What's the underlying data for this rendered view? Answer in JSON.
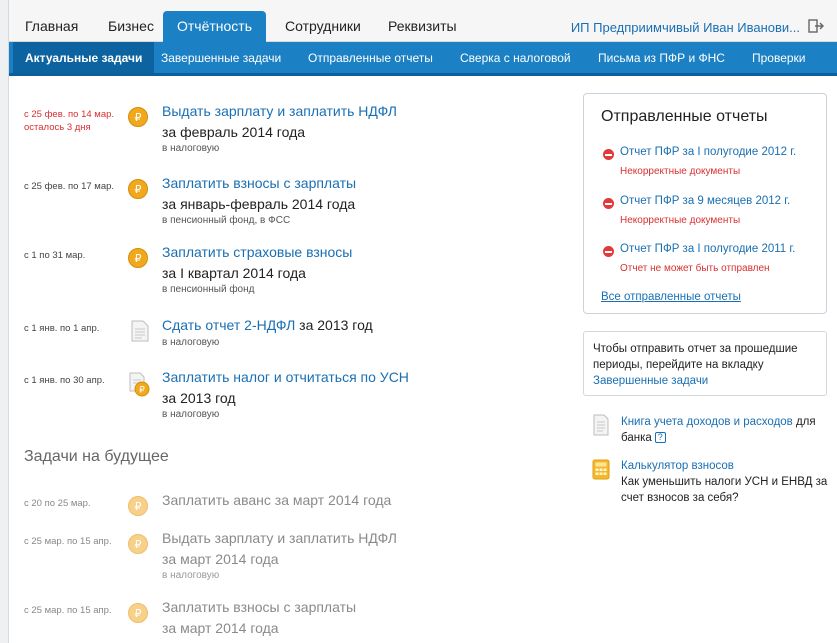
{
  "top_tabs": [
    {
      "label": "Главная"
    },
    {
      "label": "Бизнес"
    },
    {
      "label": "Отчётность"
    },
    {
      "label": "Сотрудники"
    },
    {
      "label": "Реквизиты"
    }
  ],
  "user": {
    "name": "ИП Предприимчивый Иван Иванови..."
  },
  "sub_tabs": [
    {
      "label": "Актуальные задачи"
    },
    {
      "label": "Завершенные задачи"
    },
    {
      "label": "Отправленные отчеты"
    },
    {
      "label": "Сверка с налоговой"
    },
    {
      "label": "Письма из ПФР и ФНС"
    },
    {
      "label": "Проверки"
    }
  ],
  "tasks": [
    {
      "date1": "с 25 фев. по 14 мар.",
      "date2": "осталось 3 дня",
      "title": "Выдать зарплату и заплатить НДФЛ",
      "subtitle": "за февраль 2014 года",
      "dest": "в налоговую"
    },
    {
      "date1": "с 25 фев. по 17 мар.",
      "title": "Заплатить взносы с зарплаты",
      "subtitle": "за январь-февраль 2014 года",
      "dest": "в пенсионный фонд, в ФСС"
    },
    {
      "date1": "с 1 по 31 мар.",
      "title": "Заплатить страховые взносы",
      "subtitle": "за I квартал 2014 года",
      "dest": "в пенсионный фонд"
    },
    {
      "date1": "с 1 янв. по 1 апр.",
      "title": "Сдать отчет 2-НДФЛ",
      "title_tail": " за 2013 год",
      "dest": "в налоговую"
    },
    {
      "date1": "с 1 янв. по 30 апр.",
      "title": "Заплатить налог и отчитаться по УСН",
      "subtitle": "за 2013 год",
      "dest": "в налоговую"
    }
  ],
  "future_heading": "Задачи на будущее",
  "future_tasks": [
    {
      "date1": "с 20 по 25 мар.",
      "title": "Заплатить аванс за март 2014 года"
    },
    {
      "date1": "с 25 мар. по 15 апр.",
      "title": "Выдать зарплату и заплатить НДФЛ",
      "subtitle": "за март 2014 года",
      "dest": "в налоговую"
    },
    {
      "date1": "с 25 мар. по 15 апр.",
      "title": "Заплатить взносы с зарплаты",
      "subtitle": "за март 2014 года"
    }
  ],
  "sent_reports": {
    "heading": "Отправленные отчеты",
    "items": [
      {
        "label": "Отчет ПФР за I полугодие 2012 г.",
        "status": "Некорректные документы"
      },
      {
        "label": "Отчет ПФР за 9 месяцев 2012 г.",
        "status": "Некорректные документы"
      },
      {
        "label": "Отчет ПФР за I полугодие 2011 г.",
        "status": "Отчет не может быть отправлен"
      }
    ],
    "all_link": "Все отправленные отчеты"
  },
  "info": {
    "text": "Чтобы отправить отчет за прошедшие периоды, перейдите на вкладку ",
    "link": "Завершенные задачи"
  },
  "book": {
    "link": "Книга учета доходов и расходов",
    "tail": " для банка"
  },
  "calc": {
    "link": "Калькулятор взносов",
    "text": "Как уменьшить налоги УСН и ЕНВД за счет взносов за себя?"
  },
  "colors": {
    "accent": "#1b80c4",
    "accent_dark": "#0d62a0",
    "error": "#d93030",
    "coin": "#f0a91c"
  }
}
